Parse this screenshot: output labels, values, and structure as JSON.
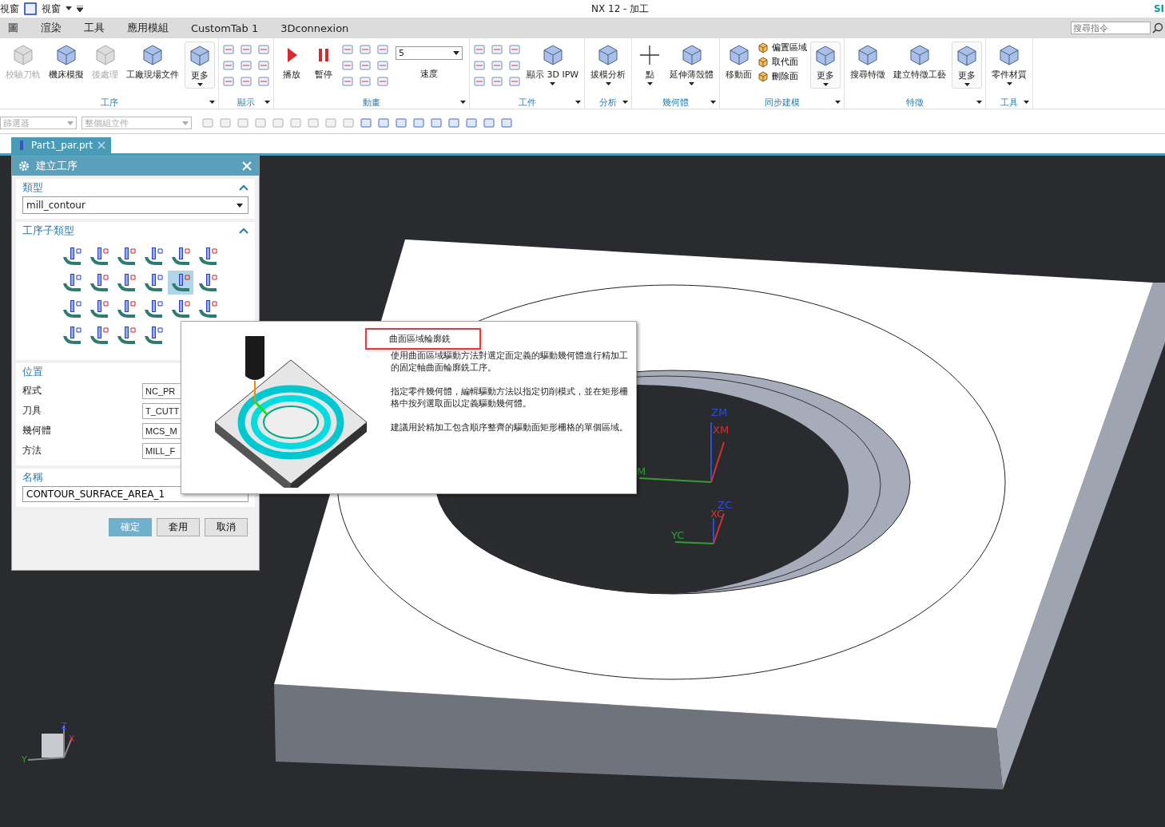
{
  "title_bar": {
    "quick_access_label": "視窗",
    "window_menu": "視窗",
    "title": "NX 12 - 加工",
    "brand": "SI"
  },
  "menu_tabs": [
    {
      "label": "圖",
      "selected": false
    },
    {
      "label": "渲染",
      "selected": false
    },
    {
      "label": "工具",
      "selected": false
    },
    {
      "label": "應用模組",
      "selected": false
    },
    {
      "label": "CustomTab 1",
      "selected": false
    },
    {
      "label": "3Dconnexion",
      "selected": false
    }
  ],
  "search": {
    "placeholder": "搜尋指令"
  },
  "ribbon": [
    {
      "label": "工序",
      "items": [
        {
          "kind": "large",
          "label": "校驗刀軌",
          "disabled": true,
          "dropdown": false
        },
        {
          "kind": "large",
          "label": "機床模擬",
          "disabled": false,
          "dropdown": false
        },
        {
          "kind": "large",
          "label": "後處理",
          "disabled": true,
          "dropdown": false
        },
        {
          "kind": "large",
          "label": "工廠現場文件",
          "disabled": false,
          "dropdown": false
        },
        {
          "kind": "more",
          "label": "更多",
          "disabled": false,
          "dropdown": true
        }
      ]
    },
    {
      "label": "顯示",
      "items": [
        {
          "kind": "icons"
        }
      ]
    },
    {
      "label": "動畫",
      "items": [
        {
          "kind": "play",
          "label": "播放",
          "disabled": false,
          "dropdown": false
        },
        {
          "kind": "pause",
          "label": "暫停",
          "disabled": false,
          "dropdown": false
        },
        {
          "kind": "icons"
        },
        {
          "kind": "speed",
          "value": "5",
          "label": "速度"
        }
      ]
    },
    {
      "label": "工件",
      "items": [
        {
          "kind": "icons"
        },
        {
          "kind": "large",
          "label": "顯示 3D IPW",
          "disabled": false,
          "dropdown": true
        }
      ]
    },
    {
      "label": "分析",
      "items": [
        {
          "kind": "large",
          "label": "拔模分析",
          "disabled": false,
          "dropdown": true
        }
      ]
    },
    {
      "label": "幾何體",
      "items": [
        {
          "kind": "point",
          "label": "點",
          "disabled": false,
          "dropdown": true
        },
        {
          "kind": "large",
          "label": "延伸薄殼體",
          "disabled": false,
          "dropdown": true
        }
      ]
    },
    {
      "label": "同步建模",
      "items": [
        {
          "kind": "large",
          "label": "移動面",
          "disabled": false,
          "dropdown": false
        },
        {
          "kind": "small",
          "labels": [
            "偏置區域",
            "取代面",
            "刪除面"
          ]
        },
        {
          "kind": "more",
          "label": "更多",
          "disabled": false,
          "dropdown": true
        }
      ]
    },
    {
      "label": "特徵",
      "items": [
        {
          "kind": "large",
          "label": "搜尋特徵",
          "disabled": false,
          "dropdown": false
        },
        {
          "kind": "large",
          "label": "建立特徵工藝",
          "disabled": false,
          "dropdown": false
        },
        {
          "kind": "more",
          "label": "更多",
          "disabled": false,
          "dropdown": true
        }
      ]
    },
    {
      "label": "工具",
      "items": [
        {
          "kind": "large",
          "label": "零件材質",
          "disabled": false,
          "dropdown": true
        }
      ]
    }
  ],
  "selection_bar": {
    "filters": [
      {
        "value": "篩選器"
      },
      {
        "value": "整個組立件"
      }
    ]
  },
  "file_tab": {
    "label": "Part1_par.prt"
  },
  "dialog": {
    "title": "建立工序",
    "type_section": {
      "label": "類型",
      "value": "mill_contour"
    },
    "subtype_section": {
      "label": "工序子類型",
      "icons": [
        {
          "selected": false
        },
        {
          "selected": false
        },
        {
          "selected": false
        },
        {
          "selected": false
        },
        {
          "selected": false
        },
        {
          "selected": false
        },
        {
          "selected": false
        },
        {
          "selected": false
        },
        {
          "selected": false
        },
        {
          "selected": false
        },
        {
          "selected": true
        },
        {
          "selected": false
        },
        {
          "selected": false
        },
        {
          "selected": false
        },
        {
          "selected": false
        },
        {
          "selected": false
        },
        {
          "selected": false
        },
        {
          "selected": false
        },
        {
          "selected": false
        },
        {
          "selected": false
        },
        {
          "selected": false
        },
        {
          "selected": false
        }
      ]
    },
    "location": {
      "label": "位置",
      "rows": [
        {
          "label": "程式",
          "value": "NC_PR"
        },
        {
          "label": "刀具",
          "value": "T_CUTT"
        },
        {
          "label": "幾何體",
          "value": "MCS_M"
        },
        {
          "label": "方法",
          "value": "MILL_F"
        }
      ]
    },
    "name_section": {
      "label": "名稱",
      "value": "CONTOUR_SURFACE_AREA_1"
    },
    "buttons": [
      {
        "label": "確定",
        "primary": true
      },
      {
        "label": "套用",
        "primary": false
      },
      {
        "label": "取消",
        "primary": false
      }
    ]
  },
  "tooltip": {
    "title": "曲面區域輪廓銑",
    "paragraphs": [
      "使用曲面區域驅動方法對選定面定義的驅動幾何體進行精加工的固定軸曲面輪廓銑工序。",
      "指定零件幾何體，編輯驅動方法以指定切削模式，並在矩形柵格中按列選取面以定義驅動幾何體。",
      "建議用於精加工包含順序整齊的驅動面矩形柵格的單個區域。"
    ]
  },
  "viewport": {
    "axis_labels": [
      "ZM",
      "XM",
      "M",
      "ZC",
      "XC",
      "YC"
    ],
    "triad_labels": [
      "Z",
      "X",
      "Y"
    ]
  }
}
